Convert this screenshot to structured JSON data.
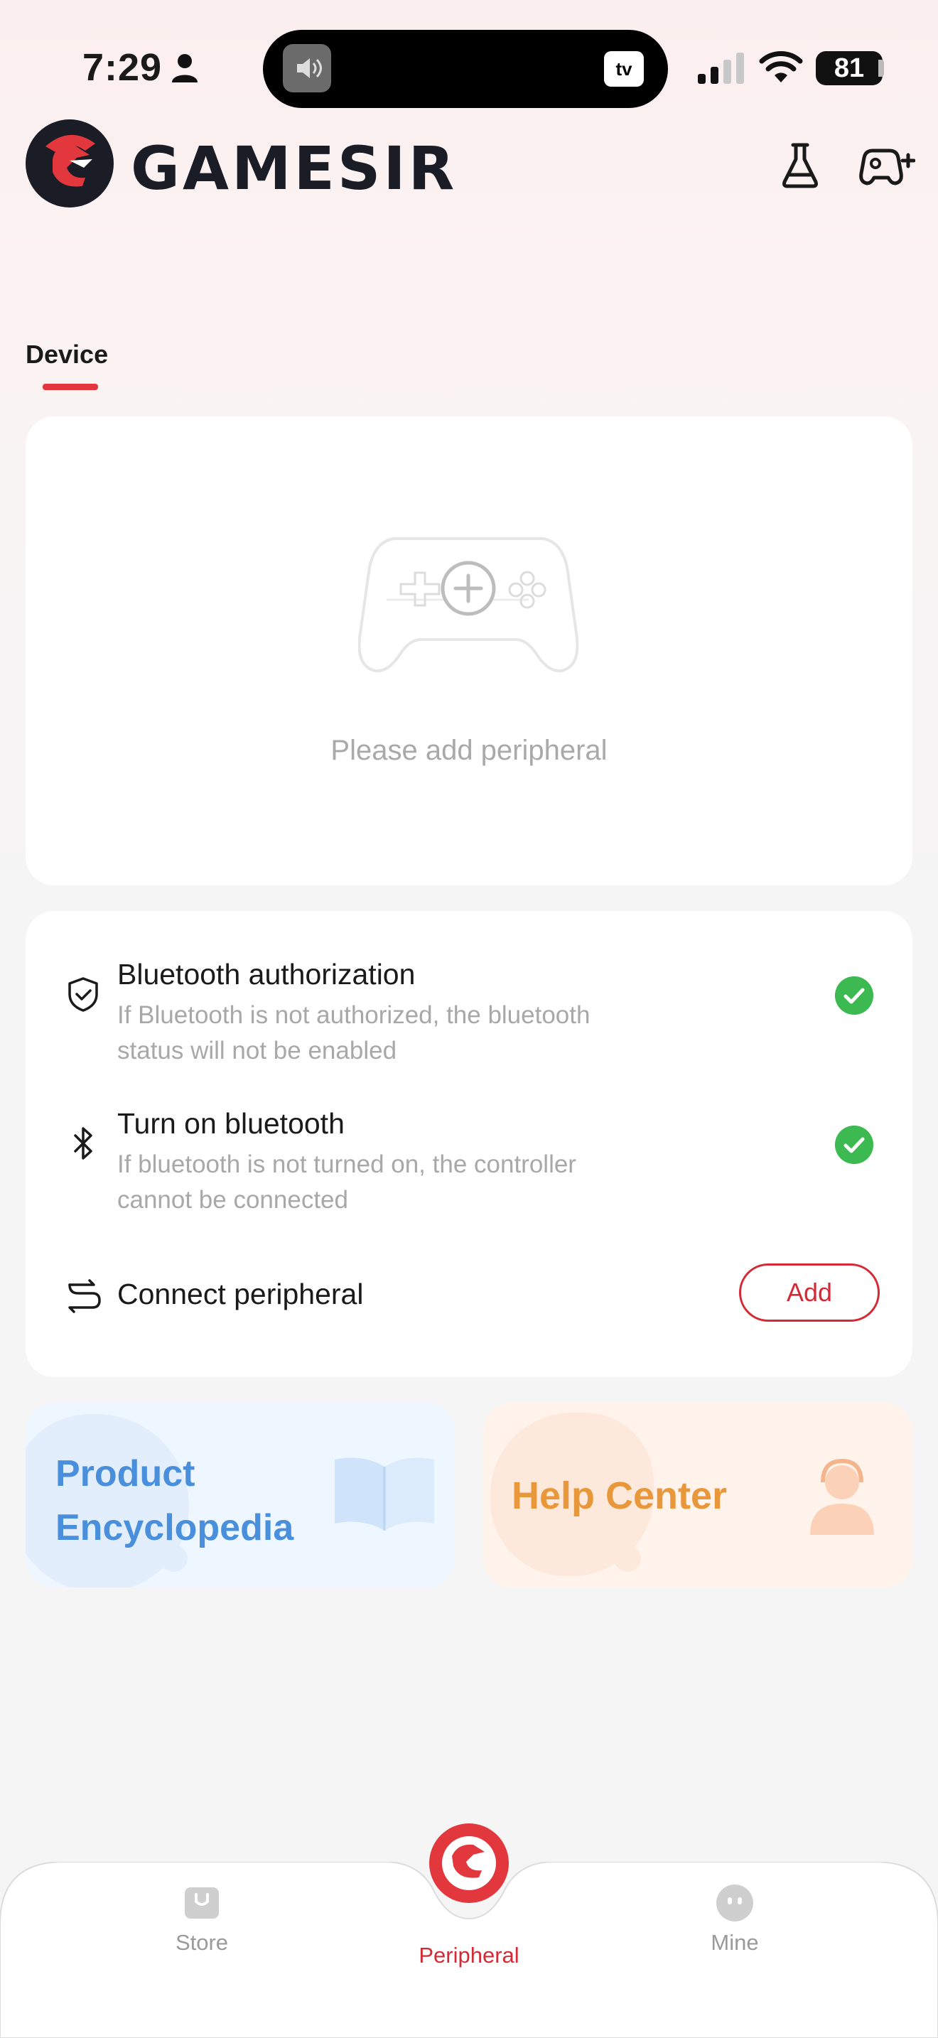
{
  "status_bar": {
    "time": "7:29",
    "battery": "81",
    "island_app": "tv"
  },
  "header": {
    "brand": "GAMESIR",
    "colors": {
      "brand_red": "#e2373c",
      "brand_dark": "#1a1d26"
    }
  },
  "tabs": [
    {
      "label": "Device",
      "active": true
    }
  ],
  "device_card": {
    "empty_text": "Please add peripheral"
  },
  "connection": {
    "bluetooth_auth": {
      "title": "Bluetooth authorization",
      "desc": "If Bluetooth is not authorized, the bluetooth status will not be enabled",
      "ok": true
    },
    "bluetooth_on": {
      "title": "Turn on bluetooth",
      "desc": "If bluetooth is not turned on, the controller cannot be connected",
      "ok": true
    },
    "connect": {
      "title": "Connect peripheral",
      "button": "Add"
    }
  },
  "tiles": {
    "encyclopedia": {
      "line1": "Product",
      "line2": "Encyclopedia"
    },
    "help": {
      "label": "Help Center"
    }
  },
  "tabbar": {
    "store": "Store",
    "peripheral": "Peripheral",
    "mine": "Mine",
    "active": "Peripheral"
  }
}
